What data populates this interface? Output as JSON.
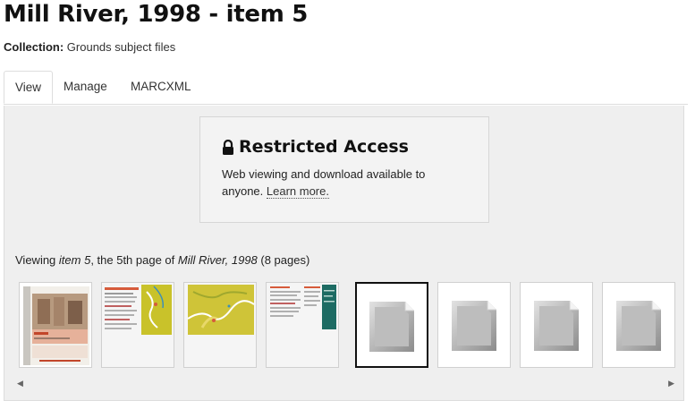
{
  "title": "Mill River, 1998 - item 5",
  "collection": {
    "label": "Collection:",
    "value": "Grounds subject files"
  },
  "tabs": [
    {
      "label": "View",
      "active": true
    },
    {
      "label": "Manage",
      "active": false
    },
    {
      "label": "MARCXML",
      "active": false
    }
  ],
  "restricted": {
    "title": "Restricted Access",
    "text": "Web viewing and download available to anyone.",
    "link": "Learn more."
  },
  "viewing": {
    "prefix": "Viewing ",
    "item": "item 5",
    "middle": ", the 5th page of ",
    "work": "Mill River, 1998",
    "suffix": " (8 pages)"
  },
  "thumbnails": [
    {
      "page": 1,
      "kind": "cover",
      "current": false
    },
    {
      "page": 2,
      "kind": "map-spread",
      "current": false
    },
    {
      "page": 3,
      "kind": "map",
      "current": false
    },
    {
      "page": 4,
      "kind": "text-spread",
      "current": false
    },
    {
      "page": 5,
      "kind": "placeholder-icon",
      "current": true
    },
    {
      "page": 6,
      "kind": "placeholder-icon",
      "current": false
    },
    {
      "page": 7,
      "kind": "placeholder-icon",
      "current": false
    },
    {
      "page": 8,
      "kind": "placeholder-icon",
      "current": false
    }
  ],
  "colors": {
    "accent_map": "#c9c22a",
    "accent_teal": "#1d6b63",
    "panel_bg": "#efefef"
  },
  "icons": [
    "lock-icon",
    "scroll-left-arrow-icon",
    "scroll-right-arrow-icon",
    "document-placeholder-icon"
  ]
}
